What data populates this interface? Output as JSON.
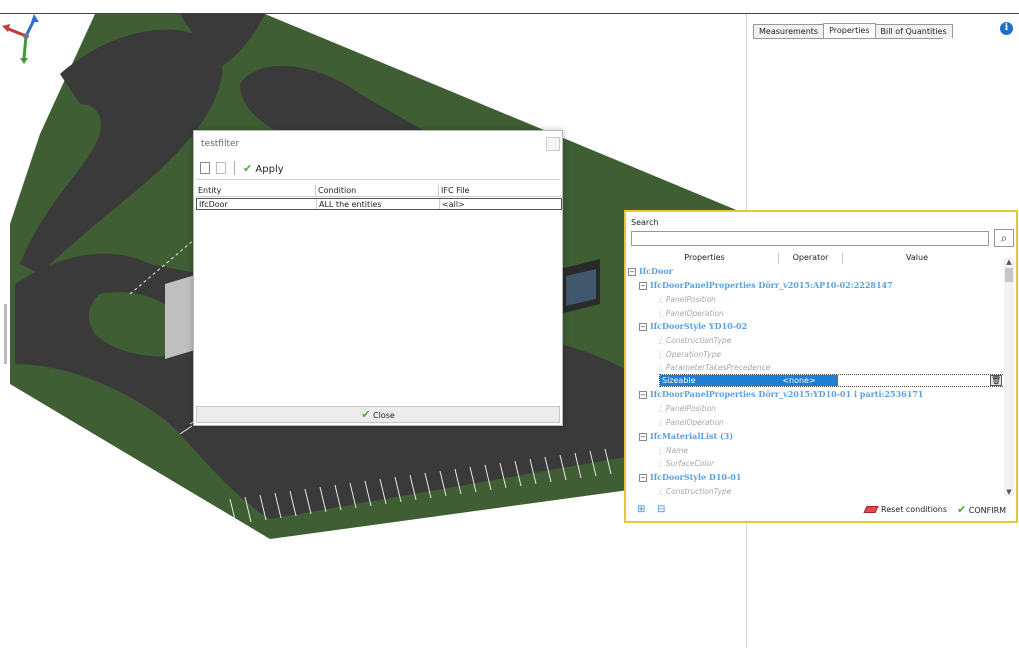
{
  "right_panel": {
    "tabs": [
      {
        "label": "Measurements",
        "active": false
      },
      {
        "label": "Properties",
        "active": true
      },
      {
        "label": "Bill of Quantities",
        "active": false
      }
    ],
    "info_icon": "info-icon"
  },
  "filter_dialog": {
    "title": "testfilter",
    "toolbar": {
      "new_icon": "new-document-icon",
      "copy_icon": "document-icon",
      "apply_label": "Apply"
    },
    "columns": [
      "Entity",
      "Condition",
      "IFC File"
    ],
    "rows": [
      {
        "entity": "IfcDoor",
        "condition": "ALL the entities",
        "ifc_file": "<all>"
      }
    ],
    "close_label": "Close"
  },
  "search_panel": {
    "label": "Search",
    "search_value": "",
    "search_button_icon": "magnifier-icon",
    "columns": [
      "Properties",
      "Operator",
      "Value"
    ],
    "tree": [
      {
        "kind": "entity",
        "level": 0,
        "label": "IfcDoor"
      },
      {
        "kind": "entity",
        "level": 1,
        "label": "IfcDoorPanelProperties Dörr_v2015:AP10-02:2228147"
      },
      {
        "kind": "prop",
        "level": 2,
        "label": "PanelPosition"
      },
      {
        "kind": "prop",
        "level": 2,
        "label": "PanelOperation"
      },
      {
        "kind": "entity",
        "level": 1,
        "label": "IfcDoorStyle YD10-02"
      },
      {
        "kind": "prop",
        "level": 2,
        "label": "ConstructionType"
      },
      {
        "kind": "prop",
        "level": 2,
        "label": "OperationType"
      },
      {
        "kind": "prop",
        "level": 2,
        "label": "ParameterTakesPrecedence"
      },
      {
        "kind": "selected",
        "level": 2,
        "label": "Sizeable"
      },
      {
        "kind": "entity",
        "level": 1,
        "label": "IfcDoorPanelProperties Dörr_v2015:YD10-01 i parti:2536171"
      },
      {
        "kind": "prop",
        "level": 2,
        "label": "PanelPosition"
      },
      {
        "kind": "prop",
        "level": 2,
        "label": "PanelOperation"
      },
      {
        "kind": "entity",
        "level": 1,
        "label": "IfcMaterialList (3)"
      },
      {
        "kind": "prop",
        "level": 2,
        "label": "Name"
      },
      {
        "kind": "prop",
        "level": 2,
        "label": "SurfaceColor"
      },
      {
        "kind": "entity",
        "level": 1,
        "label": "IfcDoorStyle D10-01"
      },
      {
        "kind": "prop",
        "level": 2,
        "label": "ConstructionType"
      }
    ],
    "selected_row": {
      "property": "Sizeable",
      "operator": "<none>",
      "value": ""
    },
    "footer": {
      "expand_icon": "expand-tree-icon",
      "collapse_icon": "collapse-tree-icon",
      "reset_label": "Reset conditions",
      "confirm_label": "CONFIRM"
    }
  },
  "viewport": {
    "navigation_gizmo": "axis-gizmo-icon",
    "colors": {
      "grass": "#3f5e33",
      "asphalt": "#3a3a3a",
      "parking_line": "#e8e8e8"
    }
  }
}
